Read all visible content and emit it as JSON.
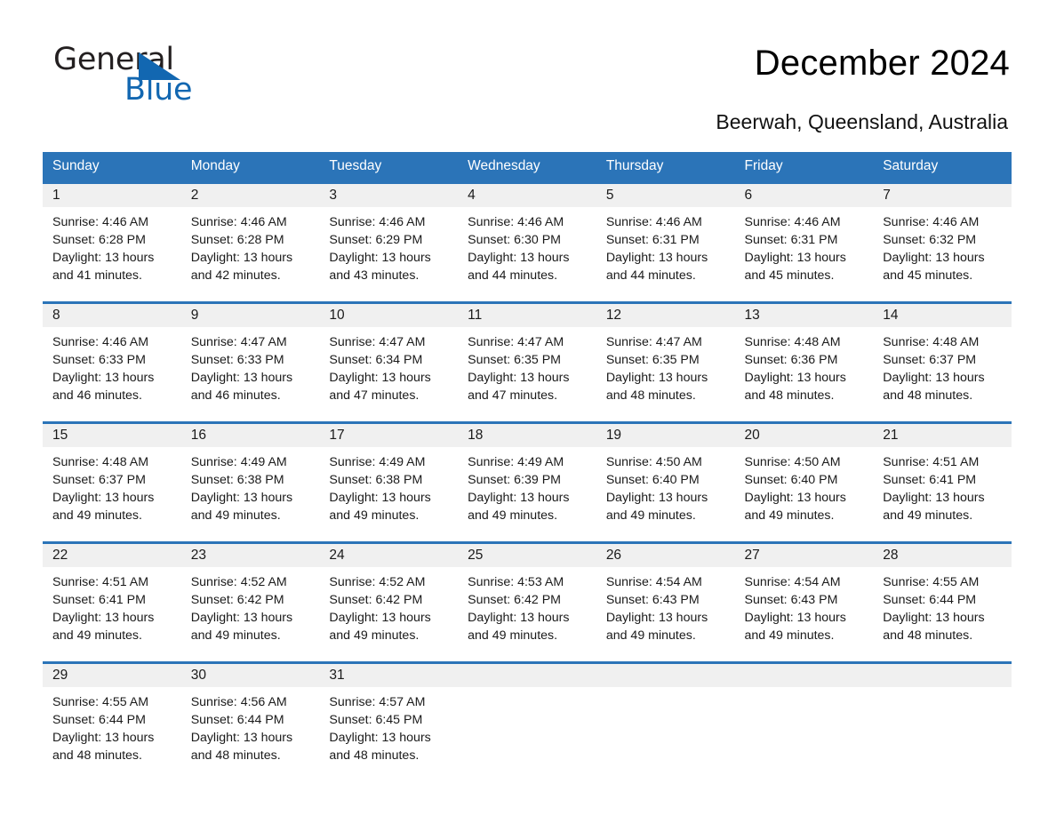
{
  "brand": {
    "name_part1": "General",
    "name_part2": "Blue",
    "accent_color": "#1267b1"
  },
  "header": {
    "title": "December 2024",
    "subtitle": "Beerwah, Queensland, Australia"
  },
  "calendar": {
    "header_bg": "#2b74b8",
    "day_band_bg": "#f0f0f0",
    "weekday_headers": [
      "Sunday",
      "Monday",
      "Tuesday",
      "Wednesday",
      "Thursday",
      "Friday",
      "Saturday"
    ],
    "weeks": [
      [
        {
          "day": "1",
          "sunrise": "Sunrise: 4:46 AM",
          "sunset": "Sunset: 6:28 PM",
          "daylight_line1": "Daylight: 13 hours",
          "daylight_line2": "and 41 minutes."
        },
        {
          "day": "2",
          "sunrise": "Sunrise: 4:46 AM",
          "sunset": "Sunset: 6:28 PM",
          "daylight_line1": "Daylight: 13 hours",
          "daylight_line2": "and 42 minutes."
        },
        {
          "day": "3",
          "sunrise": "Sunrise: 4:46 AM",
          "sunset": "Sunset: 6:29 PM",
          "daylight_line1": "Daylight: 13 hours",
          "daylight_line2": "and 43 minutes."
        },
        {
          "day": "4",
          "sunrise": "Sunrise: 4:46 AM",
          "sunset": "Sunset: 6:30 PM",
          "daylight_line1": "Daylight: 13 hours",
          "daylight_line2": "and 44 minutes."
        },
        {
          "day": "5",
          "sunrise": "Sunrise: 4:46 AM",
          "sunset": "Sunset: 6:31 PM",
          "daylight_line1": "Daylight: 13 hours",
          "daylight_line2": "and 44 minutes."
        },
        {
          "day": "6",
          "sunrise": "Sunrise: 4:46 AM",
          "sunset": "Sunset: 6:31 PM",
          "daylight_line1": "Daylight: 13 hours",
          "daylight_line2": "and 45 minutes."
        },
        {
          "day": "7",
          "sunrise": "Sunrise: 4:46 AM",
          "sunset": "Sunset: 6:32 PM",
          "daylight_line1": "Daylight: 13 hours",
          "daylight_line2": "and 45 minutes."
        }
      ],
      [
        {
          "day": "8",
          "sunrise": "Sunrise: 4:46 AM",
          "sunset": "Sunset: 6:33 PM",
          "daylight_line1": "Daylight: 13 hours",
          "daylight_line2": "and 46 minutes."
        },
        {
          "day": "9",
          "sunrise": "Sunrise: 4:47 AM",
          "sunset": "Sunset: 6:33 PM",
          "daylight_line1": "Daylight: 13 hours",
          "daylight_line2": "and 46 minutes."
        },
        {
          "day": "10",
          "sunrise": "Sunrise: 4:47 AM",
          "sunset": "Sunset: 6:34 PM",
          "daylight_line1": "Daylight: 13 hours",
          "daylight_line2": "and 47 minutes."
        },
        {
          "day": "11",
          "sunrise": "Sunrise: 4:47 AM",
          "sunset": "Sunset: 6:35 PM",
          "daylight_line1": "Daylight: 13 hours",
          "daylight_line2": "and 47 minutes."
        },
        {
          "day": "12",
          "sunrise": "Sunrise: 4:47 AM",
          "sunset": "Sunset: 6:35 PM",
          "daylight_line1": "Daylight: 13 hours",
          "daylight_line2": "and 48 minutes."
        },
        {
          "day": "13",
          "sunrise": "Sunrise: 4:48 AM",
          "sunset": "Sunset: 6:36 PM",
          "daylight_line1": "Daylight: 13 hours",
          "daylight_line2": "and 48 minutes."
        },
        {
          "day": "14",
          "sunrise": "Sunrise: 4:48 AM",
          "sunset": "Sunset: 6:37 PM",
          "daylight_line1": "Daylight: 13 hours",
          "daylight_line2": "and 48 minutes."
        }
      ],
      [
        {
          "day": "15",
          "sunrise": "Sunrise: 4:48 AM",
          "sunset": "Sunset: 6:37 PM",
          "daylight_line1": "Daylight: 13 hours",
          "daylight_line2": "and 49 minutes."
        },
        {
          "day": "16",
          "sunrise": "Sunrise: 4:49 AM",
          "sunset": "Sunset: 6:38 PM",
          "daylight_line1": "Daylight: 13 hours",
          "daylight_line2": "and 49 minutes."
        },
        {
          "day": "17",
          "sunrise": "Sunrise: 4:49 AM",
          "sunset": "Sunset: 6:38 PM",
          "daylight_line1": "Daylight: 13 hours",
          "daylight_line2": "and 49 minutes."
        },
        {
          "day": "18",
          "sunrise": "Sunrise: 4:49 AM",
          "sunset": "Sunset: 6:39 PM",
          "daylight_line1": "Daylight: 13 hours",
          "daylight_line2": "and 49 minutes."
        },
        {
          "day": "19",
          "sunrise": "Sunrise: 4:50 AM",
          "sunset": "Sunset: 6:40 PM",
          "daylight_line1": "Daylight: 13 hours",
          "daylight_line2": "and 49 minutes."
        },
        {
          "day": "20",
          "sunrise": "Sunrise: 4:50 AM",
          "sunset": "Sunset: 6:40 PM",
          "daylight_line1": "Daylight: 13 hours",
          "daylight_line2": "and 49 minutes."
        },
        {
          "day": "21",
          "sunrise": "Sunrise: 4:51 AM",
          "sunset": "Sunset: 6:41 PM",
          "daylight_line1": "Daylight: 13 hours",
          "daylight_line2": "and 49 minutes."
        }
      ],
      [
        {
          "day": "22",
          "sunrise": "Sunrise: 4:51 AM",
          "sunset": "Sunset: 6:41 PM",
          "daylight_line1": "Daylight: 13 hours",
          "daylight_line2": "and 49 minutes."
        },
        {
          "day": "23",
          "sunrise": "Sunrise: 4:52 AM",
          "sunset": "Sunset: 6:42 PM",
          "daylight_line1": "Daylight: 13 hours",
          "daylight_line2": "and 49 minutes."
        },
        {
          "day": "24",
          "sunrise": "Sunrise: 4:52 AM",
          "sunset": "Sunset: 6:42 PM",
          "daylight_line1": "Daylight: 13 hours",
          "daylight_line2": "and 49 minutes."
        },
        {
          "day": "25",
          "sunrise": "Sunrise: 4:53 AM",
          "sunset": "Sunset: 6:42 PM",
          "daylight_line1": "Daylight: 13 hours",
          "daylight_line2": "and 49 minutes."
        },
        {
          "day": "26",
          "sunrise": "Sunrise: 4:54 AM",
          "sunset": "Sunset: 6:43 PM",
          "daylight_line1": "Daylight: 13 hours",
          "daylight_line2": "and 49 minutes."
        },
        {
          "day": "27",
          "sunrise": "Sunrise: 4:54 AM",
          "sunset": "Sunset: 6:43 PM",
          "daylight_line1": "Daylight: 13 hours",
          "daylight_line2": "and 49 minutes."
        },
        {
          "day": "28",
          "sunrise": "Sunrise: 4:55 AM",
          "sunset": "Sunset: 6:44 PM",
          "daylight_line1": "Daylight: 13 hours",
          "daylight_line2": "and 48 minutes."
        }
      ],
      [
        {
          "day": "29",
          "sunrise": "Sunrise: 4:55 AM",
          "sunset": "Sunset: 6:44 PM",
          "daylight_line1": "Daylight: 13 hours",
          "daylight_line2": "and 48 minutes."
        },
        {
          "day": "30",
          "sunrise": "Sunrise: 4:56 AM",
          "sunset": "Sunset: 6:44 PM",
          "daylight_line1": "Daylight: 13 hours",
          "daylight_line2": "and 48 minutes."
        },
        {
          "day": "31",
          "sunrise": "Sunrise: 4:57 AM",
          "sunset": "Sunset: 6:45 PM",
          "daylight_line1": "Daylight: 13 hours",
          "daylight_line2": "and 48 minutes."
        },
        {
          "day": "",
          "sunrise": "",
          "sunset": "",
          "daylight_line1": "",
          "daylight_line2": ""
        },
        {
          "day": "",
          "sunrise": "",
          "sunset": "",
          "daylight_line1": "",
          "daylight_line2": ""
        },
        {
          "day": "",
          "sunrise": "",
          "sunset": "",
          "daylight_line1": "",
          "daylight_line2": ""
        },
        {
          "day": "",
          "sunrise": "",
          "sunset": "",
          "daylight_line1": "",
          "daylight_line2": ""
        }
      ]
    ]
  }
}
